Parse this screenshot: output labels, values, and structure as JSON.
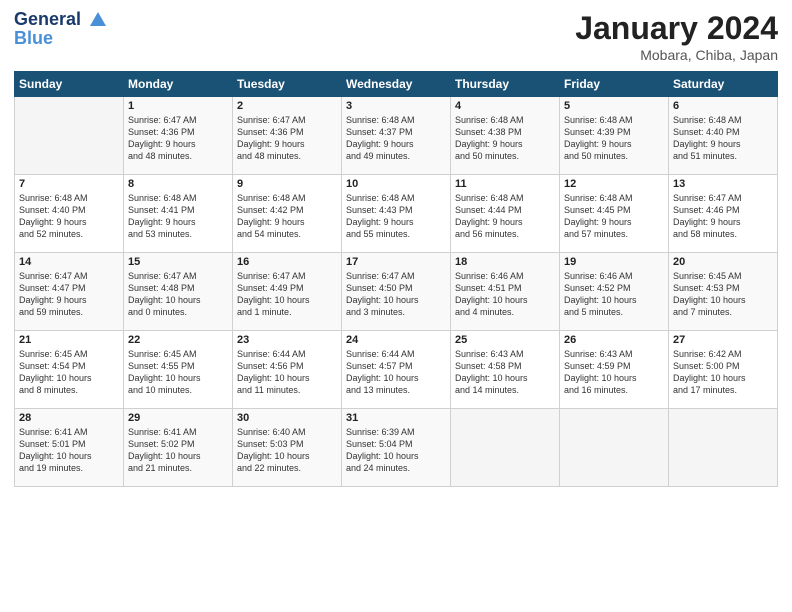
{
  "header": {
    "logo_line1": "General",
    "logo_line2": "Blue",
    "month_title": "January 2024",
    "location": "Mobara, Chiba, Japan"
  },
  "weekdays": [
    "Sunday",
    "Monday",
    "Tuesday",
    "Wednesday",
    "Thursday",
    "Friday",
    "Saturday"
  ],
  "weeks": [
    [
      {
        "day": "",
        "sunrise": "",
        "sunset": "",
        "daylight": ""
      },
      {
        "day": "1",
        "sunrise": "Sunrise: 6:47 AM",
        "sunset": "Sunset: 4:36 PM",
        "daylight": "Daylight: 9 hours and 48 minutes."
      },
      {
        "day": "2",
        "sunrise": "Sunrise: 6:47 AM",
        "sunset": "Sunset: 4:36 PM",
        "daylight": "Daylight: 9 hours and 48 minutes."
      },
      {
        "day": "3",
        "sunrise": "Sunrise: 6:48 AM",
        "sunset": "Sunset: 4:37 PM",
        "daylight": "Daylight: 9 hours and 49 minutes."
      },
      {
        "day": "4",
        "sunrise": "Sunrise: 6:48 AM",
        "sunset": "Sunset: 4:38 PM",
        "daylight": "Daylight: 9 hours and 50 minutes."
      },
      {
        "day": "5",
        "sunrise": "Sunrise: 6:48 AM",
        "sunset": "Sunset: 4:39 PM",
        "daylight": "Daylight: 9 hours and 50 minutes."
      },
      {
        "day": "6",
        "sunrise": "Sunrise: 6:48 AM",
        "sunset": "Sunset: 4:40 PM",
        "daylight": "Daylight: 9 hours and 51 minutes."
      }
    ],
    [
      {
        "day": "7",
        "sunrise": "Sunrise: 6:48 AM",
        "sunset": "Sunset: 4:40 PM",
        "daylight": "Daylight: 9 hours and 52 minutes."
      },
      {
        "day": "8",
        "sunrise": "Sunrise: 6:48 AM",
        "sunset": "Sunset: 4:41 PM",
        "daylight": "Daylight: 9 hours and 53 minutes."
      },
      {
        "day": "9",
        "sunrise": "Sunrise: 6:48 AM",
        "sunset": "Sunset: 4:42 PM",
        "daylight": "Daylight: 9 hours and 54 minutes."
      },
      {
        "day": "10",
        "sunrise": "Sunrise: 6:48 AM",
        "sunset": "Sunset: 4:43 PM",
        "daylight": "Daylight: 9 hours and 55 minutes."
      },
      {
        "day": "11",
        "sunrise": "Sunrise: 6:48 AM",
        "sunset": "Sunset: 4:44 PM",
        "daylight": "Daylight: 9 hours and 56 minutes."
      },
      {
        "day": "12",
        "sunrise": "Sunrise: 6:48 AM",
        "sunset": "Sunset: 4:45 PM",
        "daylight": "Daylight: 9 hours and 57 minutes."
      },
      {
        "day": "13",
        "sunrise": "Sunrise: 6:47 AM",
        "sunset": "Sunset: 4:46 PM",
        "daylight": "Daylight: 9 hours and 58 minutes."
      }
    ],
    [
      {
        "day": "14",
        "sunrise": "Sunrise: 6:47 AM",
        "sunset": "Sunset: 4:47 PM",
        "daylight": "Daylight: 9 hours and 59 minutes."
      },
      {
        "day": "15",
        "sunrise": "Sunrise: 6:47 AM",
        "sunset": "Sunset: 4:48 PM",
        "daylight": "Daylight: 10 hours and 0 minutes."
      },
      {
        "day": "16",
        "sunrise": "Sunrise: 6:47 AM",
        "sunset": "Sunset: 4:49 PM",
        "daylight": "Daylight: 10 hours and 1 minute."
      },
      {
        "day": "17",
        "sunrise": "Sunrise: 6:47 AM",
        "sunset": "Sunset: 4:50 PM",
        "daylight": "Daylight: 10 hours and 3 minutes."
      },
      {
        "day": "18",
        "sunrise": "Sunrise: 6:46 AM",
        "sunset": "Sunset: 4:51 PM",
        "daylight": "Daylight: 10 hours and 4 minutes."
      },
      {
        "day": "19",
        "sunrise": "Sunrise: 6:46 AM",
        "sunset": "Sunset: 4:52 PM",
        "daylight": "Daylight: 10 hours and 5 minutes."
      },
      {
        "day": "20",
        "sunrise": "Sunrise: 6:45 AM",
        "sunset": "Sunset: 4:53 PM",
        "daylight": "Daylight: 10 hours and 7 minutes."
      }
    ],
    [
      {
        "day": "21",
        "sunrise": "Sunrise: 6:45 AM",
        "sunset": "Sunset: 4:54 PM",
        "daylight": "Daylight: 10 hours and 8 minutes."
      },
      {
        "day": "22",
        "sunrise": "Sunrise: 6:45 AM",
        "sunset": "Sunset: 4:55 PM",
        "daylight": "Daylight: 10 hours and 10 minutes."
      },
      {
        "day": "23",
        "sunrise": "Sunrise: 6:44 AM",
        "sunset": "Sunset: 4:56 PM",
        "daylight": "Daylight: 10 hours and 11 minutes."
      },
      {
        "day": "24",
        "sunrise": "Sunrise: 6:44 AM",
        "sunset": "Sunset: 4:57 PM",
        "daylight": "Daylight: 10 hours and 13 minutes."
      },
      {
        "day": "25",
        "sunrise": "Sunrise: 6:43 AM",
        "sunset": "Sunset: 4:58 PM",
        "daylight": "Daylight: 10 hours and 14 minutes."
      },
      {
        "day": "26",
        "sunrise": "Sunrise: 6:43 AM",
        "sunset": "Sunset: 4:59 PM",
        "daylight": "Daylight: 10 hours and 16 minutes."
      },
      {
        "day": "27",
        "sunrise": "Sunrise: 6:42 AM",
        "sunset": "Sunset: 5:00 PM",
        "daylight": "Daylight: 10 hours and 17 minutes."
      }
    ],
    [
      {
        "day": "28",
        "sunrise": "Sunrise: 6:41 AM",
        "sunset": "Sunset: 5:01 PM",
        "daylight": "Daylight: 10 hours and 19 minutes."
      },
      {
        "day": "29",
        "sunrise": "Sunrise: 6:41 AM",
        "sunset": "Sunset: 5:02 PM",
        "daylight": "Daylight: 10 hours and 21 minutes."
      },
      {
        "day": "30",
        "sunrise": "Sunrise: 6:40 AM",
        "sunset": "Sunset: 5:03 PM",
        "daylight": "Daylight: 10 hours and 22 minutes."
      },
      {
        "day": "31",
        "sunrise": "Sunrise: 6:39 AM",
        "sunset": "Sunset: 5:04 PM",
        "daylight": "Daylight: 10 hours and 24 minutes."
      },
      {
        "day": "",
        "sunrise": "",
        "sunset": "",
        "daylight": ""
      },
      {
        "day": "",
        "sunrise": "",
        "sunset": "",
        "daylight": ""
      },
      {
        "day": "",
        "sunrise": "",
        "sunset": "",
        "daylight": ""
      }
    ]
  ]
}
